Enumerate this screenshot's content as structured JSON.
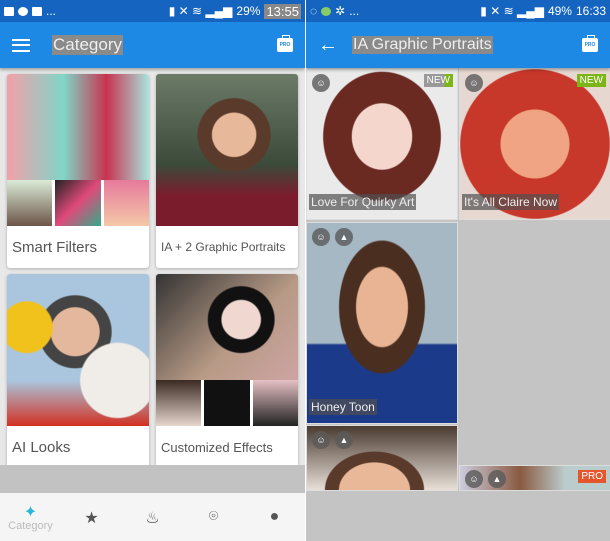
{
  "left": {
    "status": {
      "icons": [
        "image-icon",
        "info-icon",
        "youtube-icon"
      ],
      "more": "...",
      "battery": "29%",
      "time": "13:55"
    },
    "appbar": {
      "title": "Category",
      "pro_label": "PRO"
    },
    "cards": [
      {
        "label": "Smart Filters"
      },
      {
        "label": "IA + 2 Graphic Portraits"
      },
      {
        "label": "AI Looks"
      },
      {
        "label": "Customized Effects"
      }
    ],
    "nav": [
      {
        "label": "Category",
        "icon": "magic-wand-icon",
        "active": true
      },
      {
        "label": "",
        "icon": "star-icon"
      },
      {
        "label": "",
        "icon": "fire-icon"
      },
      {
        "label": "",
        "icon": "face-scan-icon"
      },
      {
        "label": "",
        "icon": "person-icon"
      }
    ]
  },
  "right": {
    "status": {
      "more": "...",
      "battery": "49%",
      "time": "16:33"
    },
    "appbar": {
      "title": "IA Graphic Portraits",
      "pro_label": "PRO"
    },
    "tiles": [
      {
        "caption": "Love For Quirky Art",
        "badge": "NEW"
      },
      {
        "caption": "It's All Claire Now",
        "badge": "NEW"
      },
      {
        "caption": "Honey Toon",
        "badge": ""
      },
      {
        "caption": "",
        "badge": ""
      },
      {
        "caption": "",
        "badge": "PRO"
      }
    ]
  },
  "colors": {
    "primary": "#1e88e5",
    "status": "#1565c0",
    "new_badge": "#7cb518",
    "pro_badge": "#e4572e",
    "nav_active": "#29b6d8"
  }
}
